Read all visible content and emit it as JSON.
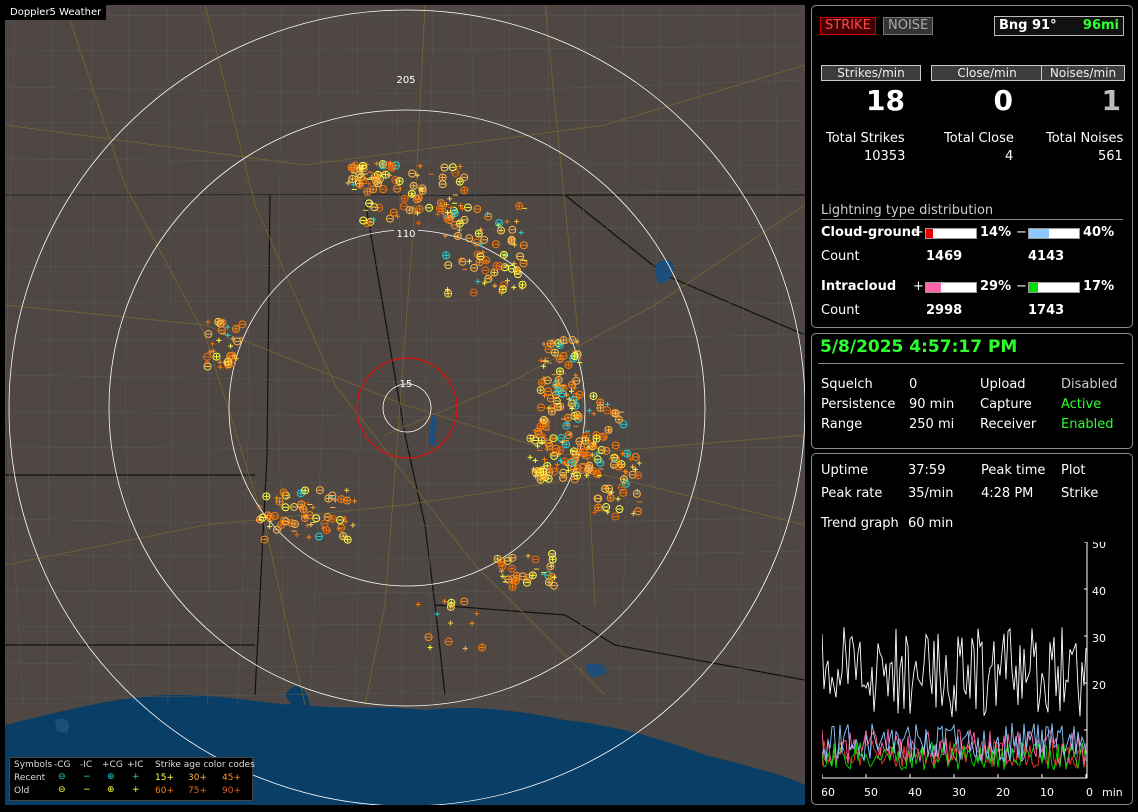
{
  "app_title": "Doppler5 Weather",
  "map": {
    "range_labels": [
      "205",
      "110",
      "15"
    ],
    "legend": {
      "row0": [
        "Symbols",
        "-CG",
        "-IC",
        "+CG",
        "+IC",
        "Strike age color codes"
      ],
      "row1_label": "Recent",
      "row2_label": "Old",
      "age_codes_recent": [
        "15+",
        "30+",
        "45+"
      ],
      "age_codes_old": [
        "60+",
        "75+",
        "90+"
      ],
      "age_colors": [
        "#ffff44",
        "#ffb347",
        "#ff8c1a",
        "#ff7a00",
        "#e86a10",
        "#d85a20"
      ]
    }
  },
  "status": {
    "strike_label": "STRIKE",
    "noise_label": "NOISE",
    "bearing": "Bng 91°",
    "distance": "96mi",
    "rates": [
      {
        "label": "Strikes/min",
        "value": "18",
        "total_label": "Total Strikes",
        "total": "10353"
      },
      {
        "label": "Close/min",
        "value": "0",
        "total_label": "Total Close",
        "total": "4"
      },
      {
        "label": "Noises/min",
        "value": "1",
        "total_label": "Total Noises",
        "total": "561"
      }
    ],
    "distribution_title": "Lightning type distribution",
    "cloud_ground": {
      "label": "Cloud-ground",
      "pos_sign": "+",
      "pos_pct": "14%",
      "pos_fill": 0.14,
      "pos_color": "#e00000",
      "neg_sign": "−",
      "neg_pct": "40%",
      "neg_fill": 0.4,
      "neg_color": "#8ec9ff",
      "count_label": "Count",
      "pos_count": "1469",
      "neg_count": "4143"
    },
    "intracloud": {
      "label": "Intracloud",
      "pos_sign": "+",
      "pos_pct": "29%",
      "pos_fill": 0.29,
      "pos_color": "#ff66aa",
      "neg_sign": "−",
      "neg_pct": "17%",
      "neg_fill": 0.17,
      "neg_color": "#00e000",
      "count_label": "Count",
      "pos_count": "2998",
      "neg_count": "1743"
    }
  },
  "info": {
    "datetime": "5/8/2025 4:57:17 PM",
    "rows": [
      {
        "k1": "Squelch",
        "v1": "0",
        "k2": "Upload",
        "v2": "Disabled",
        "c2": "#cccccc"
      },
      {
        "k1": "Persistence",
        "v1": "90 min",
        "k2": "Capture",
        "v2": "Active",
        "c2": "#2dff2d"
      },
      {
        "k1": "Range",
        "v1": "250 mi",
        "k2": "Receiver",
        "v2": "Enabled",
        "c2": "#2dff2d"
      }
    ]
  },
  "trend": {
    "uptime_label": "Uptime",
    "uptime": "37:59",
    "peak_time_label": "Peak time",
    "peak_time": "4:28 PM",
    "plot_label": "Plot",
    "peak_rate_label": "Peak rate",
    "peak_rate": "35/min",
    "plot_value": "Strike",
    "trend_label": "Trend graph",
    "trend_value": "60 min",
    "y_ticks": [
      "50",
      "40",
      "30",
      "20"
    ],
    "x_ticks": [
      "60",
      "50",
      "40",
      "30",
      "20",
      "10",
      "0"
    ],
    "x_unit": "min"
  }
}
